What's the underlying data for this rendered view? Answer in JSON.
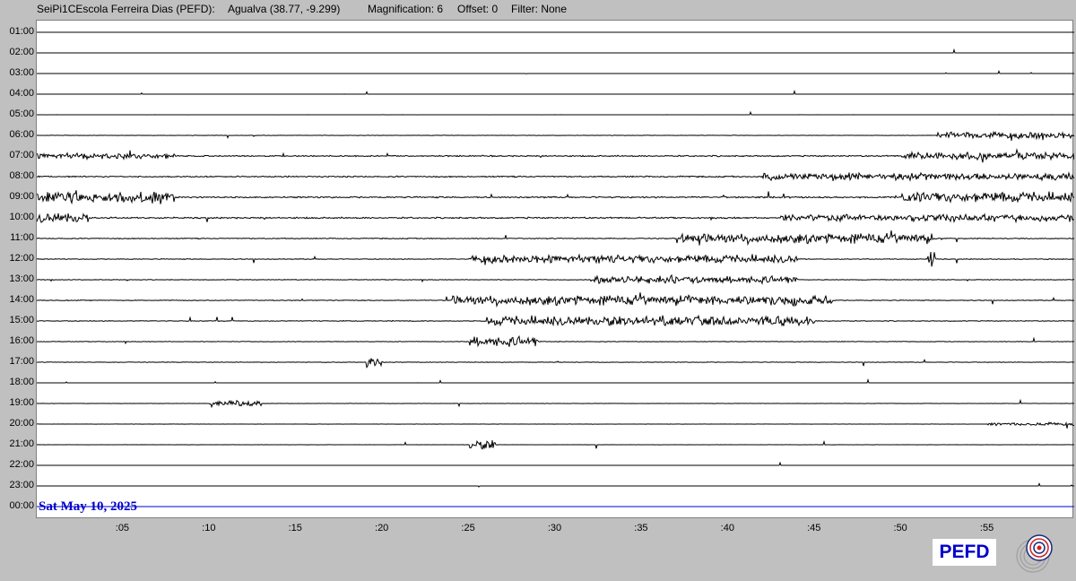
{
  "header": {
    "station": "SeiPi1CEscola Ferreira Dias (PEFD):",
    "location": "Agualva (38.77, -9.299)",
    "magnification": "Magnification: 6",
    "offset": "Offset: 0",
    "filter": "Filter: None"
  },
  "hours": [
    "01:00",
    "02:00",
    "03:00",
    "04:00",
    "05:00",
    "06:00",
    "07:00",
    "08:00",
    "09:00",
    "10:00",
    "11:00",
    "12:00",
    "13:00",
    "14:00",
    "15:00",
    "16:00",
    "17:00",
    "18:00",
    "19:00",
    "20:00",
    "21:00",
    "22:00",
    "23:00",
    "00:00"
  ],
  "minute_ticks": [
    ":05",
    ":10",
    ":15",
    ":20",
    ":25",
    ":30",
    ":35",
    ":40",
    ":45",
    ":50",
    ":55"
  ],
  "date": "Sat May 10, 2025",
  "station_code": "PEFD",
  "trace_activity": [
    {
      "hour": "01:00",
      "level": 0.03
    },
    {
      "hour": "02:00",
      "level": 0.03
    },
    {
      "hour": "03:00",
      "level": 0.03
    },
    {
      "hour": "04:00",
      "level": 0.03
    },
    {
      "hour": "05:00",
      "level": 0.05
    },
    {
      "hour": "06:00",
      "level": 0.2,
      "bursts": [
        [
          52,
          60,
          4
        ]
      ]
    },
    {
      "hour": "07:00",
      "level": 0.7,
      "bursts": [
        [
          0,
          8,
          3
        ],
        [
          50,
          60,
          4
        ]
      ]
    },
    {
      "hour": "08:00",
      "level": 0.7,
      "bursts": [
        [
          42,
          60,
          4
        ]
      ]
    },
    {
      "hour": "09:00",
      "level": 0.8,
      "bursts": [
        [
          0,
          8,
          6
        ],
        [
          50,
          60,
          6
        ]
      ]
    },
    {
      "hour": "10:00",
      "level": 0.8,
      "bursts": [
        [
          0,
          3,
          6
        ],
        [
          43,
          60,
          4
        ]
      ]
    },
    {
      "hour": "11:00",
      "level": 0.5,
      "bursts": [
        [
          37,
          52,
          6
        ]
      ]
    },
    {
      "hour": "12:00",
      "level": 0.4,
      "bursts": [
        [
          25,
          44,
          5
        ],
        [
          51.5,
          52,
          12
        ]
      ]
    },
    {
      "hour": "13:00",
      "level": 0.3,
      "bursts": [
        [
          32,
          44,
          5
        ]
      ]
    },
    {
      "hour": "14:00",
      "level": 0.4,
      "bursts": [
        [
          24,
          46,
          6
        ]
      ]
    },
    {
      "hour": "15:00",
      "level": 0.4,
      "bursts": [
        [
          26,
          45,
          6
        ]
      ]
    },
    {
      "hour": "16:00",
      "level": 0.3,
      "bursts": [
        [
          25,
          29,
          7
        ]
      ]
    },
    {
      "hour": "17:00",
      "level": 0.3,
      "bursts": [
        [
          19,
          20,
          7
        ]
      ]
    },
    {
      "hour": "18:00",
      "level": 0.03
    },
    {
      "hour": "19:00",
      "level": 0.15,
      "bursts": [
        [
          10,
          13,
          4
        ]
      ]
    },
    {
      "hour": "20:00",
      "level": 0.1,
      "bursts": [
        [
          55,
          60,
          2
        ]
      ]
    },
    {
      "hour": "21:00",
      "level": 0.1,
      "bursts": [
        [
          25,
          26.5,
          6
        ]
      ]
    },
    {
      "hour": "22:00",
      "level": 0.03
    },
    {
      "hour": "23:00",
      "level": 0.03
    },
    {
      "hour": "00:00",
      "level": 0.0
    }
  ],
  "colors": {
    "trace": "#000000",
    "current": "#0000cc",
    "background": "#c0c0c0",
    "plot": "#ffffff"
  }
}
